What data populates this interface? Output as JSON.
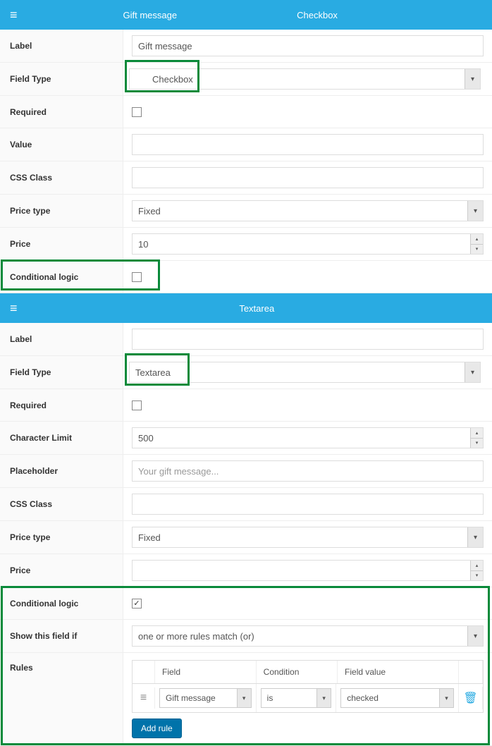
{
  "section1": {
    "header_title": "Gift message",
    "header_type": "Checkbox",
    "label_lbl": "Label",
    "label_val": "Gift message",
    "fieldtype_lbl": "Field Type",
    "fieldtype_val": "Checkbox",
    "required_lbl": "Required",
    "value_lbl": "Value",
    "value_val": "",
    "css_lbl": "CSS Class",
    "css_val": "",
    "pricetype_lbl": "Price type",
    "pricetype_val": "Fixed",
    "price_lbl": "Price",
    "price_val": "10",
    "condlogic_lbl": "Conditional logic"
  },
  "section2": {
    "header_type": "Textarea",
    "label_lbl": "Label",
    "label_val": "",
    "fieldtype_lbl": "Field Type",
    "fieldtype_val": "Textarea",
    "required_lbl": "Required",
    "charlimit_lbl": "Character Limit",
    "charlimit_val": "500",
    "placeholder_lbl": "Placeholder",
    "placeholder_val": "Your gift message...",
    "css_lbl": "CSS Class",
    "css_val": "",
    "pricetype_lbl": "Price type",
    "pricetype_val": "Fixed",
    "price_lbl": "Price",
    "price_val": "",
    "condlogic_lbl": "Conditional logic",
    "showif_lbl": "Show this field if",
    "showif_val": "one or more rules match (or)",
    "rules_lbl": "Rules",
    "rules_hdr_field": "Field",
    "rules_hdr_cond": "Condition",
    "rules_hdr_val": "Field value",
    "rule_field": "Gift message",
    "rule_cond": "is",
    "rule_val": "checked",
    "add_rule": "Add rule"
  }
}
